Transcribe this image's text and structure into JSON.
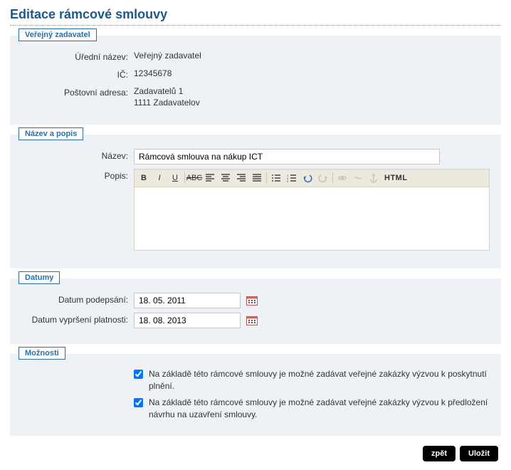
{
  "page": {
    "title": "Editace rámcové smlouvy"
  },
  "fieldsets": {
    "zadavatel": {
      "legend": "Veřejný zadavatel",
      "rows": {
        "uredni_nazev": {
          "label": "Úřední název:",
          "value": "Veřejný zadavatel"
        },
        "ic": {
          "label": "IČ:",
          "value": "12345678"
        },
        "adresa": {
          "label": "Poštovní adresa:",
          "value_line1": "Zadavatelů 1",
          "value_line2": "1111 Zadavatelov"
        }
      }
    },
    "nazev_popis": {
      "legend": "Název a popis",
      "nazev": {
        "label": "Název:",
        "value": "Rámcová smlouva na nákup ICT"
      },
      "popis": {
        "label": "Popis:",
        "value": ""
      }
    },
    "datumy": {
      "legend": "Datumy",
      "podepsani": {
        "label": "Datum podepsání:",
        "value": "18. 05. 2011"
      },
      "vyprseni": {
        "label": "Datum vypršení platnosti:",
        "value": "18. 08. 2013"
      }
    },
    "moznosti": {
      "legend": "Možnosti",
      "opt1": {
        "checked": true,
        "label": "Na základě této rámcové smlouvy je možné zadávat veřejné zakázky výzvou k poskytnutí plnění."
      },
      "opt2": {
        "checked": true,
        "label": "Na základě této rámcové smlouvy je možné zadávat veřejné zakázky výzvou k předložení návrhu na uzavření smlouvy."
      }
    }
  },
  "toolbar": {
    "bold": "B",
    "italic": "I",
    "underline": "U",
    "strike": "ABC",
    "html": "HTML"
  },
  "buttons": {
    "back": "zpět",
    "save": "Uložit"
  }
}
